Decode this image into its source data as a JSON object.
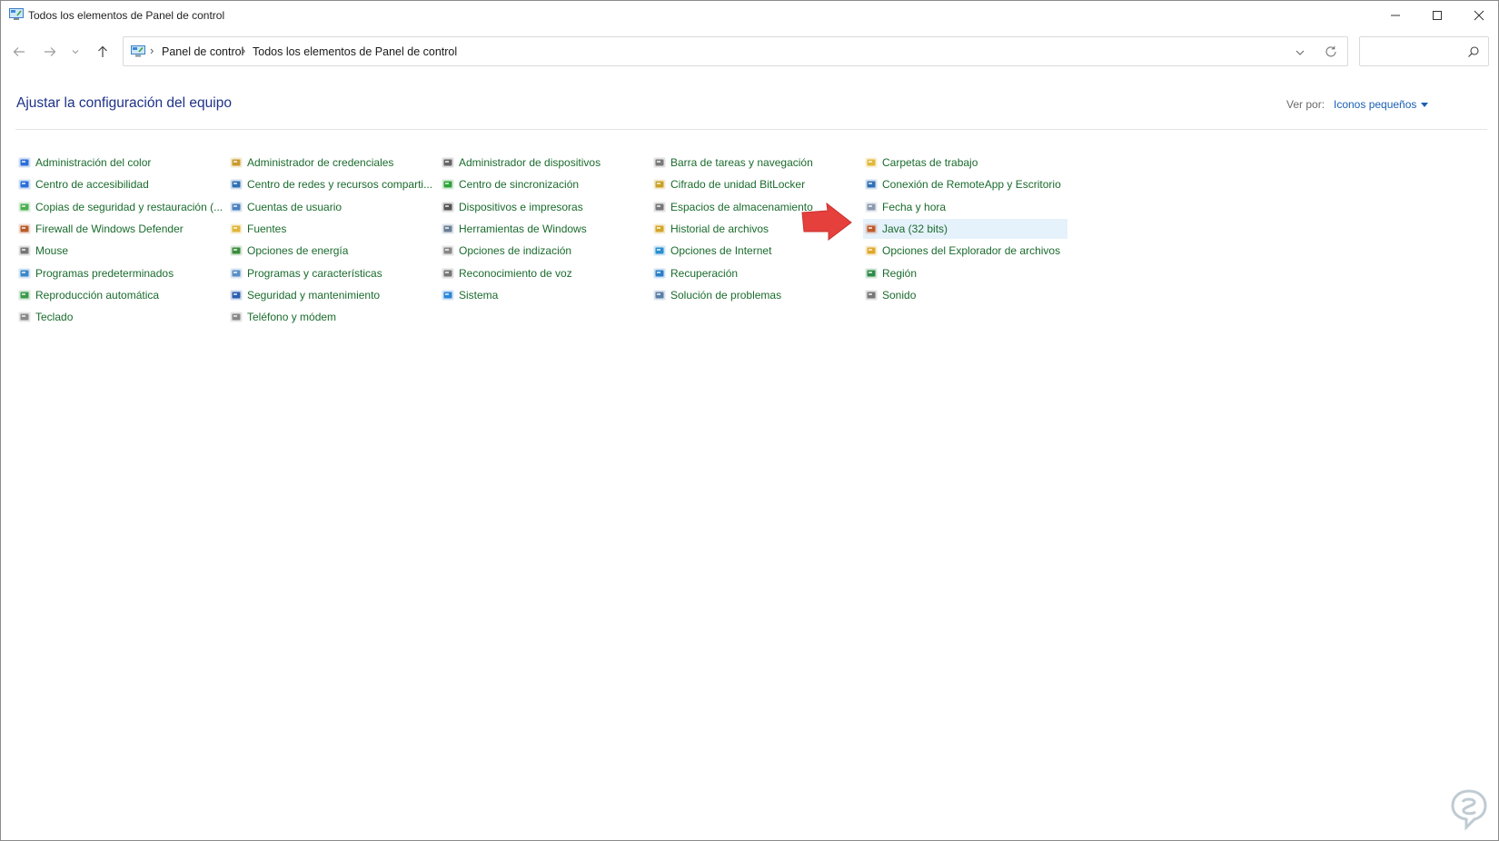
{
  "window": {
    "title": "Todos los elementos de Panel de control"
  },
  "nav": {
    "breadcrumb": [
      "Panel de control",
      "Todos los elementos de Panel de control"
    ],
    "search_placeholder": ""
  },
  "header": {
    "title": "Ajustar la configuración del equipo",
    "view_label": "Ver por:",
    "view_value": "Iconos pequeños"
  },
  "columns": [
    [
      {
        "label": "Administración del color",
        "icon": "color-management-icon",
        "color": "#2e6fd8"
      },
      {
        "label": "Centro de accesibilidad",
        "icon": "accessibility-icon",
        "color": "#2a6fd6"
      },
      {
        "label": "Copias de seguridad y restauración (...",
        "icon": "backup-restore-icon",
        "color": "#4caf50"
      },
      {
        "label": "Firewall de Windows Defender",
        "icon": "firewall-icon",
        "color": "#b85c2c"
      },
      {
        "label": "Mouse",
        "icon": "mouse-icon",
        "color": "#777777"
      },
      {
        "label": "Programas predeterminados",
        "icon": "default-programs-icon",
        "color": "#3a86c8"
      },
      {
        "label": "Reproducción automática",
        "icon": "autoplay-icon",
        "color": "#3b9a4d"
      },
      {
        "label": "Teclado",
        "icon": "keyboard-icon",
        "color": "#8a8a8a"
      }
    ],
    [
      {
        "label": "Administrador de credenciales",
        "icon": "credential-manager-icon",
        "color": "#c99a2e"
      },
      {
        "label": "Centro de redes y recursos comparti...",
        "icon": "network-center-icon",
        "color": "#2f6fb5"
      },
      {
        "label": "Cuentas de usuario",
        "icon": "user-accounts-icon",
        "color": "#4a7fc0"
      },
      {
        "label": "Fuentes",
        "icon": "fonts-icon",
        "color": "#e0b53a"
      },
      {
        "label": "Opciones de energía",
        "icon": "power-options-icon",
        "color": "#3c8c3c"
      },
      {
        "label": "Programas y características",
        "icon": "programs-features-icon",
        "color": "#5a8fc6"
      },
      {
        "label": "Seguridad y mantenimiento",
        "icon": "security-maintenance-icon",
        "color": "#2b5fb0"
      },
      {
        "label": "Teléfono y módem",
        "icon": "phone-modem-icon",
        "color": "#888888"
      }
    ],
    [
      {
        "label": "Administrador de dispositivos",
        "icon": "device-manager-icon",
        "color": "#666666"
      },
      {
        "label": "Centro de sincronización",
        "icon": "sync-center-icon",
        "color": "#2fa33a"
      },
      {
        "label": "Dispositivos e impresoras",
        "icon": "devices-printers-icon",
        "color": "#555555"
      },
      {
        "label": "Herramientas de Windows",
        "icon": "windows-tools-icon",
        "color": "#6b7f96"
      },
      {
        "label": "Opciones de indización",
        "icon": "indexing-options-icon",
        "color": "#888888"
      },
      {
        "label": "Reconocimiento de voz",
        "icon": "speech-recognition-icon",
        "color": "#777777"
      },
      {
        "label": "Sistema",
        "icon": "system-icon",
        "color": "#2b86d6"
      }
    ],
    [
      {
        "label": "Barra de tareas y navegación",
        "icon": "taskbar-icon",
        "color": "#7a7a7a"
      },
      {
        "label": "Cifrado de unidad BitLocker",
        "icon": "bitlocker-icon",
        "color": "#c9a227"
      },
      {
        "label": "Espacios de almacenamiento",
        "icon": "storage-spaces-icon",
        "color": "#777777"
      },
      {
        "label": "Historial de archivos",
        "icon": "file-history-icon",
        "color": "#d3a62a"
      },
      {
        "label": "Opciones de Internet",
        "icon": "internet-options-icon",
        "color": "#2a8fd0"
      },
      {
        "label": "Recuperación",
        "icon": "recovery-icon",
        "color": "#2a7fc8"
      },
      {
        "label": "Solución de problemas",
        "icon": "troubleshooting-icon",
        "color": "#5a7fa8"
      }
    ],
    [
      {
        "label": "Carpetas de trabajo",
        "icon": "work-folders-icon",
        "color": "#e2b83a"
      },
      {
        "label": "Conexión de RemoteApp y Escritorio",
        "icon": "remoteapp-icon",
        "color": "#2f6fb5"
      },
      {
        "label": "Fecha y hora",
        "icon": "date-time-icon",
        "color": "#8a9ab0"
      },
      {
        "label": "Java (32 bits)",
        "icon": "java-icon",
        "color": "#c05a2a",
        "highlighted": true
      },
      {
        "label": "Opciones del Explorador de archivos",
        "icon": "explorer-options-icon",
        "color": "#e0a82a"
      },
      {
        "label": "Región",
        "icon": "region-icon",
        "color": "#2f8a4a"
      },
      {
        "label": "Sonido",
        "icon": "sound-icon",
        "color": "#777777"
      }
    ]
  ],
  "colors": {
    "link_green": "#1a6b2d",
    "title_blue": "#1e3287",
    "highlight": "#e5f1fb",
    "arrow_red": "#e5403c"
  }
}
